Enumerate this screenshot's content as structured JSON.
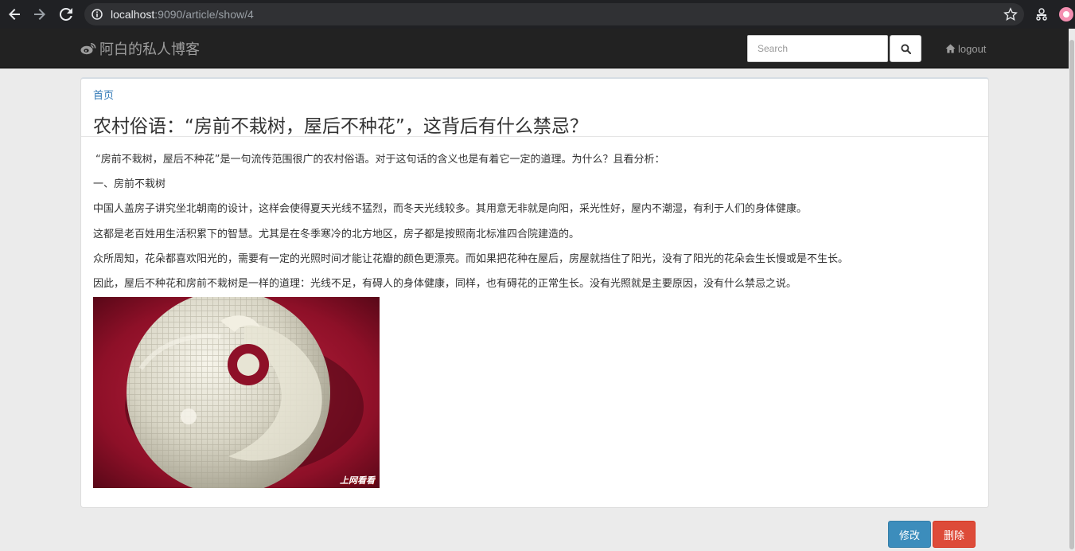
{
  "browser": {
    "url_host": "localhost",
    "url_rest": ":9090/article/show/4",
    "icons": [
      "back-icon",
      "forward-icon",
      "reload-icon",
      "info-icon",
      "star-icon",
      "extension-icon",
      "profile-icon"
    ]
  },
  "navbar": {
    "brand": "阿白的私人博客",
    "search_placeholder": "Search",
    "logout_label": "logout"
  },
  "article": {
    "breadcrumb": "首页",
    "title": "农村俗语：“房前不栽树，屋后不种花”，这背后有什么禁忌？",
    "paragraphs": [
      "“房前不栽树，屋后不种花”是一句流传范围很广的农村俗语。对于这句话的含义也是有着它一定的道理。为什么？且看分析：",
      "一、房前不栽树",
      "中国人盖房子讲究坐北朝南的设计，这样会使得夏天光线不猛烈，而冬天光线较多。其用意无非就是向阳，采光性好，屋内不潮湿，有利于人们的身体健康。",
      "这都是老百姓用生活积累下的智慧。尤其是在冬季寒冷的北方地区，房子都是按照南北标准四合院建造的。",
      "众所周知，花朵都喜欢阳光的，需要有一定的光照时间才能让花瓣的颜色更漂亮。而如果把花种在屋后，房屋就挡住了阳光，没有了阳光的花朵会生长慢或是不生长。",
      "因此，屋后不种花和房前不栽树是一样的道理：光线不足，有碍人的身体健康，同样，也有碍花的正常生长。没有光照就是主要原因，没有什么禁忌之说。"
    ],
    "image_watermark": "上网看看"
  },
  "actions": {
    "edit_label": "修改",
    "delete_label": "删除"
  },
  "colors": {
    "navbar_bg": "#222222",
    "link": "#337ab7",
    "edit_button": "#3c8dbc",
    "delete_button": "#dd4b39"
  }
}
